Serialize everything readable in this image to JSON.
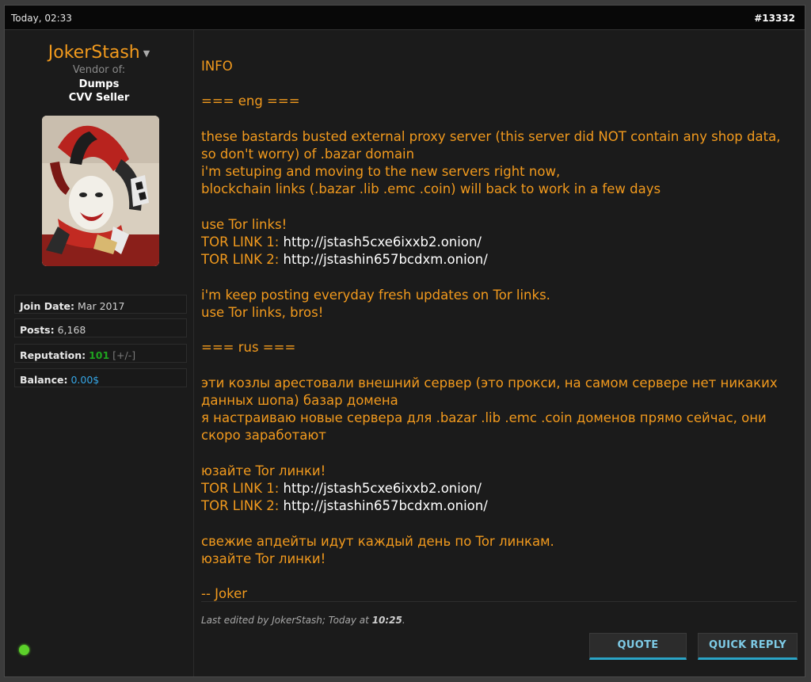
{
  "header": {
    "date": "Today, 02:33",
    "post_number": "#13332"
  },
  "user": {
    "name": "JokerStash",
    "dropdown_icon": "caret-down-icon",
    "vendor_label": "Vendor of:",
    "vendor_items": [
      "Dumps",
      "CVV Seller"
    ],
    "avatar_icon": "jester-avatar-image",
    "info": {
      "join_label": "Join Date:",
      "join_value": "Mar 2017",
      "posts_label": "Posts:",
      "posts_value": "6,168",
      "rep_label": "Reputation:",
      "rep_value": "101",
      "rep_links": "[+/-]",
      "balance_label": "Balance:",
      "balance_value": "0.00$"
    },
    "online_status_icon": "online-indicator-icon"
  },
  "post": {
    "title": "INFO",
    "eng_header": "=== eng ===",
    "eng_p1": [
      "these bastards busted external proxy server (this server did NOT contain any shop data, so don't worry) of .bazar domain",
      "i'm setuping and moving to the new servers right now,",
      "blockchain links (.bazar .lib .emc .coin) will back to work in a few days"
    ],
    "eng_tor_intro": "use Tor links!",
    "tor1_label": "TOR LINK 1: ",
    "tor1_url": "http://jstash5cxe6ixxb2.onion/",
    "tor2_label": "TOR LINK 2: ",
    "tor2_url": "http://jstashin657bcdxm.onion/",
    "eng_p3": [
      "i'm keep posting everyday fresh updates on Tor links.",
      "use Tor links, bros!"
    ],
    "rus_header": "=== rus ===",
    "rus_p1": [
      "эти козлы арестовали внешний сервер (это прокси, на самом сервере нет никаких данных шопа) базар домена",
      "я настраиваю новые сервера для .bazar .lib .emc .coin доменов прямо сейчас, они скоро заработают"
    ],
    "rus_tor_intro": "юзайте Tor линки!",
    "rus_p3": [
      "свежие апдейты идут каждый день по Tor линкам.",
      "юзайте Tor линки!"
    ],
    "signature": "-- Joker",
    "edited_text": "Last edited by JokerStash; Today at ",
    "edited_time": "10:25",
    "edited_suffix": "."
  },
  "buttons": {
    "quote": "QUOTE",
    "quick_reply": "QUICK REPLY"
  },
  "colors": {
    "accent": "#f29a1d",
    "link": "#ffffff",
    "button_underline": "#2aa4c6",
    "online": "#5cd12a"
  }
}
